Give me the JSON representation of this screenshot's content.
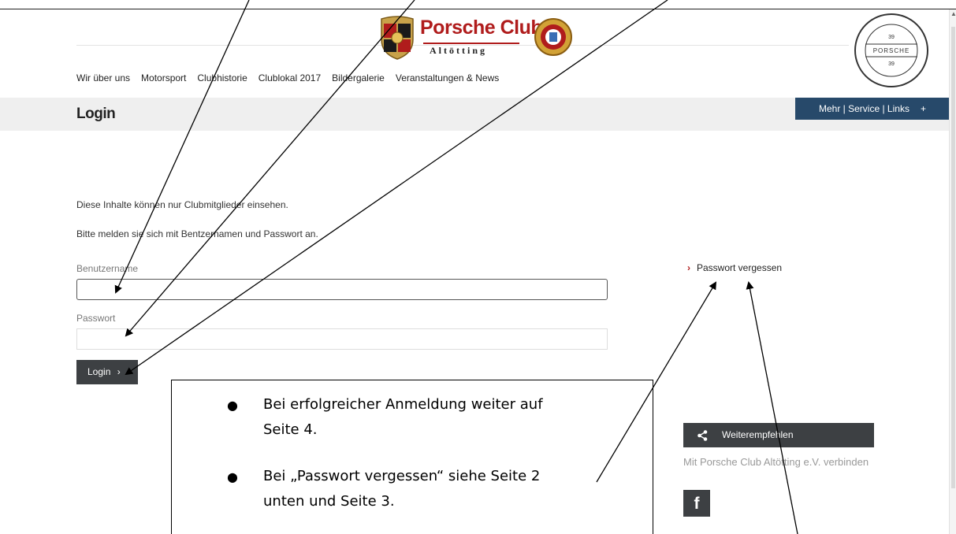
{
  "brand": {
    "title": "Porsche Club",
    "subtitle": "Altötting",
    "seal_icon": "porsche-approved-seal-icon"
  },
  "nav": {
    "items": [
      "Wir über uns",
      "Motorsport",
      "Clubhistorie",
      "Clublokal 2017",
      "Bildergalerie",
      "Veranstaltungen & News"
    ]
  },
  "page": {
    "title": "Login",
    "service_label": "Mehr | Service | Links",
    "service_plus": "+"
  },
  "content": {
    "notice_1": "Diese Inhalte können nur Clubmitglieder einsehen.",
    "notice_2": "Bitte melden sie sich mit Bentzernamen und Passwort an."
  },
  "form": {
    "username_label": "Benutzername",
    "username_value": "",
    "password_label": "Passwort",
    "password_value": "",
    "login_label": "Login",
    "login_chevron": "›"
  },
  "sidebar": {
    "forgot_chevron": "›",
    "forgot_label": "Passwort vergessen",
    "share_label": "Weiterempfehlen",
    "connect_text": "Mit Porsche Club Altötting e.V. verbinden",
    "facebook_glyph": "f"
  },
  "callout": {
    "bullets": [
      {
        "line1": "Bei erfolgreicher Anmeldung weiter auf",
        "line2": "Seite 4."
      },
      {
        "line1": "Bei „Passwort vergessen“ siehe Seite 2",
        "line2": "unten und Seite 3."
      }
    ]
  },
  "colors": {
    "accent_red": "#b01c1c",
    "nav_blue": "#27496a",
    "button_dark": "#3d4043"
  }
}
